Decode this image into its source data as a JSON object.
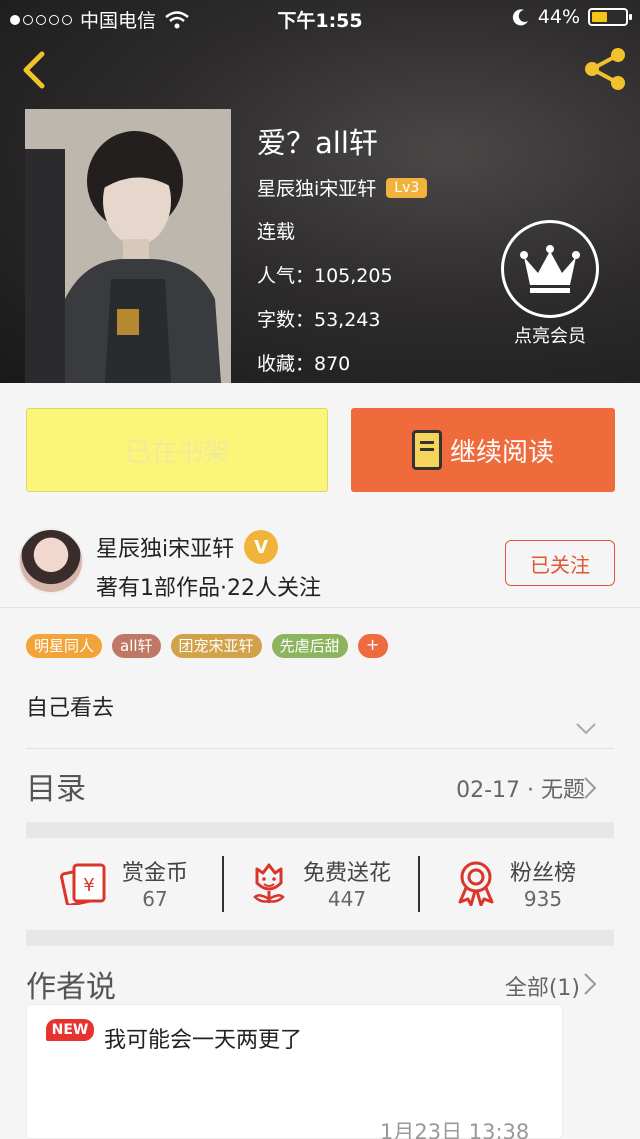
{
  "status_bar": {
    "carrier": "中国电信",
    "time": "下午1:55",
    "battery_text": "44%",
    "battery_level": 0.44,
    "signal_bars": 1
  },
  "book": {
    "title": "爱？all轩",
    "author": "星辰独i宋亚轩",
    "level": "Lv3",
    "status": "连载",
    "popularity": "人气：105,205",
    "word_count": "字数：53,243",
    "favorites": "收藏：870",
    "vip_label": "点亮会员"
  },
  "actions": {
    "shelf_label": "已在书架",
    "read_label": "继续阅读"
  },
  "author_row": {
    "name": "星辰独i宋亚轩",
    "verified_badge": "V",
    "summary": "著有1部作品·22人关注",
    "follow_label": "已关注"
  },
  "tags": [
    {
      "label": "明星同人",
      "color": "#f2a43a"
    },
    {
      "label": "all轩",
      "color": "#c07866"
    },
    {
      "label": "团宠宋亚轩",
      "color": "#d1a24a"
    },
    {
      "label": "先虐后甜",
      "color": "#8cb45e"
    }
  ],
  "tag_add": "+",
  "intro": "自己看去",
  "toc": {
    "label": "目录",
    "latest": "02-17 · 无题"
  },
  "stats": [
    {
      "name": "赏金币",
      "value": "67",
      "icon": "coin-envelope-icon"
    },
    {
      "name": "免费送花",
      "value": "447",
      "icon": "flower-icon"
    },
    {
      "name": "粉丝榜",
      "value": "935",
      "icon": "ribbon-medal-icon"
    }
  ],
  "author_notes": {
    "heading": "作者说",
    "all_link": "全部(1)",
    "new_badge": "NEW",
    "text": "我可能会一天两更了",
    "time": "1月23日  13:38"
  },
  "colors": {
    "accent_orange": "#ef6b3c",
    "shelf_yellow": "#fbf57a",
    "follow_red": "#e25535",
    "level_gold": "#f2b33d"
  }
}
